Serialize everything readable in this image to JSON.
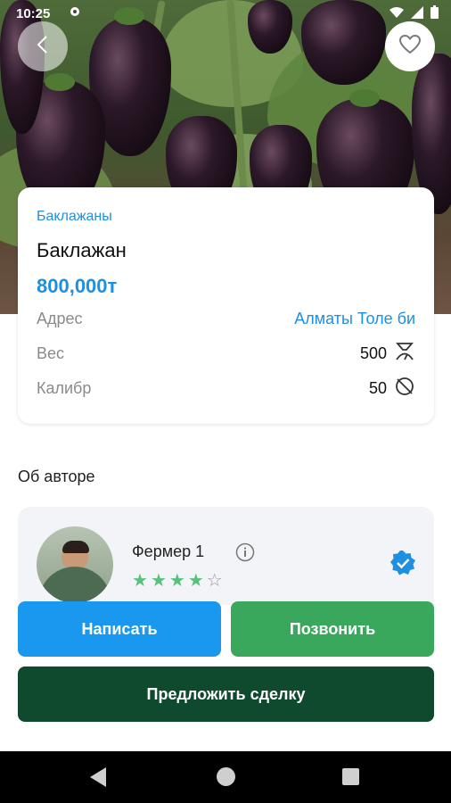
{
  "status_bar": {
    "time": "10:25"
  },
  "product": {
    "category": "Баклажаны",
    "title": "Баклажан",
    "price": "800,000т",
    "details": [
      {
        "label": "Адрес",
        "value": "Алматы Толе би",
        "icon": ""
      },
      {
        "label": "Вес",
        "value": "500",
        "icon": "scale-icon"
      },
      {
        "label": "Калибр",
        "value": "50",
        "icon": "caliber-icon"
      }
    ]
  },
  "author_section": {
    "title": "Об авторе",
    "name": "Фермер 1",
    "rating": 4,
    "rating_max": 5
  },
  "actions": {
    "write": "Написать",
    "call": "Позвонить",
    "deal": "Предложить сделку"
  },
  "colors": {
    "accent_blue": "#1e8fe1",
    "call_green": "#3aa85c",
    "deal_dark_green": "#0f4a2f",
    "star_green": "#58c27d"
  }
}
